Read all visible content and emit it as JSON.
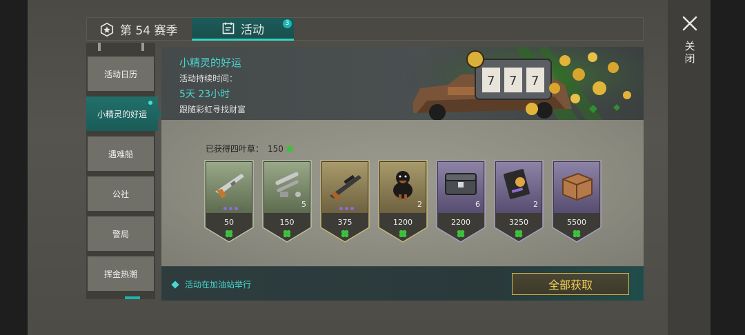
{
  "window": {
    "close_label": "关闭"
  },
  "tabs": [
    {
      "label": "第 54 赛季",
      "icon": "season-badge-icon"
    },
    {
      "label": "活动",
      "icon": "calendar-icon",
      "badge": "3"
    }
  ],
  "sidebar": {
    "items": [
      {
        "label": "活动日历"
      },
      {
        "label": "小精灵的好运",
        "active": true
      },
      {
        "label": "遇难船"
      },
      {
        "label": "公社"
      },
      {
        "label": "警局"
      },
      {
        "label": "挥金热潮"
      }
    ]
  },
  "banner": {
    "title": "小精灵的好运",
    "duration_label": "活动持续时间：",
    "duration": "5天 23小时",
    "description": "跟随彩虹寻找财富",
    "art": "slot-machine-truck-image"
  },
  "rewards": {
    "label": "已获得四叶草：",
    "count": "150",
    "items": [
      {
        "name": "shotgun",
        "cost": "50",
        "qty": "",
        "theme": "green",
        "dots": 5
      },
      {
        "name": "weapon-parts",
        "cost": "150",
        "qty": "5",
        "theme": "green",
        "dots": 0
      },
      {
        "name": "rifle",
        "cost": "375",
        "qty": "",
        "theme": "gold",
        "dots": 5
      },
      {
        "name": "rottweiler-dog",
        "cost": "1200",
        "qty": "2",
        "theme": "gold",
        "dots": 0
      },
      {
        "name": "ammo-chest",
        "cost": "2200",
        "qty": "6",
        "theme": "purple",
        "dots": 0
      },
      {
        "name": "police-badge-wallet",
        "cost": "3250",
        "qty": "2",
        "theme": "purple",
        "dots": 0
      },
      {
        "name": "wooden-crate",
        "cost": "5500",
        "qty": "",
        "theme": "purple",
        "dots": 0
      }
    ]
  },
  "footer": {
    "note": "活动在加油站举行",
    "claim_all": "全部获取"
  },
  "colors": {
    "accent": "#48d8cf",
    "gold": "#f0cf55",
    "green_card": "#6b7a58",
    "gold_card": "#7d7048",
    "purple_card": "#6a5d85"
  }
}
